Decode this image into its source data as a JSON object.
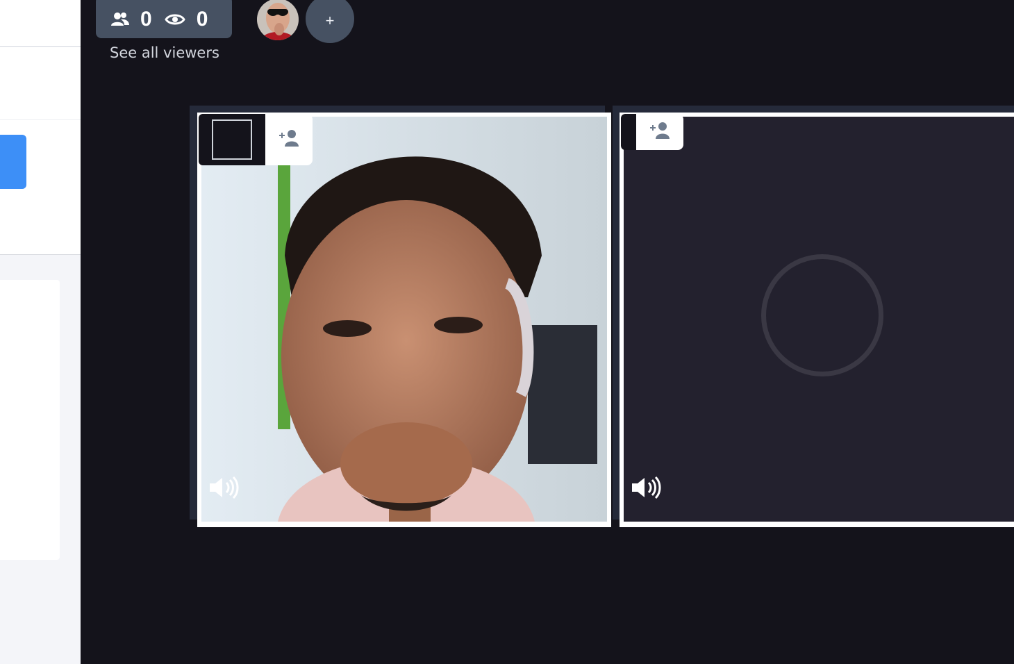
{
  "header": {
    "users_count": "0",
    "viewers_count": "0",
    "see_all_viewers_label": "See all viewers",
    "add_avatar_label": "+"
  },
  "icons": {
    "users": "users-icon",
    "eye": "eye-icon",
    "add_user": "add-user-icon",
    "speaker": "speaker-volume-icon"
  },
  "colors": {
    "background": "#14131b",
    "pill": "#465162",
    "accent_blue": "#3d8ff7",
    "tile_border": "#ffffff"
  }
}
